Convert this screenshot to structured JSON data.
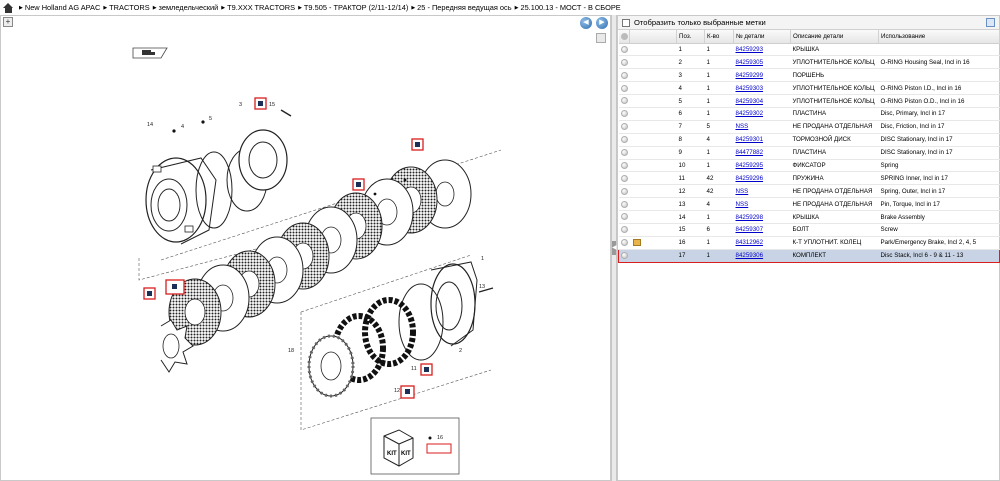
{
  "breadcrumb": [
    "New Holland AG APAC",
    "TRACTORS",
    "земледельческий",
    "T9.XXX TRACTORS",
    "T9.505 - ТРАКТОР (2/11-12/14)",
    "25 - Передняя ведущая ось",
    "25.100.13 - МОСТ - В СБОРЕ"
  ],
  "filter": {
    "label": "Отобразить только выбранные метки"
  },
  "table": {
    "headers": [
      "Поз.",
      "К-во",
      "№ детали",
      "Описание детали",
      "Использование"
    ],
    "rows": [
      {
        "pos": "1",
        "qty": "1",
        "part": "84259293",
        "desc": "КРЫШКА",
        "use": ""
      },
      {
        "pos": "2",
        "qty": "1",
        "part": "84259305",
        "desc": "УПЛОТНИТЕЛЬНОЕ КОЛЬЦ",
        "use": "O-RING Housing Seal, Incl in 16"
      },
      {
        "pos": "3",
        "qty": "1",
        "part": "84259299",
        "desc": "ПОРШЕНЬ",
        "use": ""
      },
      {
        "pos": "4",
        "qty": "1",
        "part": "84259303",
        "desc": "УПЛОТНИТЕЛЬНОЕ КОЛЬЦ",
        "use": "O-RING Piston I.D., Incl in 16"
      },
      {
        "pos": "5",
        "qty": "1",
        "part": "84259304",
        "desc": "УПЛОТНИТЕЛЬНОЕ КОЛЬЦ",
        "use": "O-RING Piston O.D., Incl in 16"
      },
      {
        "pos": "6",
        "qty": "1",
        "part": "84259302",
        "desc": "ПЛАСТИНА",
        "use": "Disc, Primary, Incl in 17"
      },
      {
        "pos": "7",
        "qty": "5",
        "part": "NSS",
        "desc": "НЕ ПРОДАНА ОТДЕЛЬНАЯ",
        "use": "Disc, Friction, Incl in 17"
      },
      {
        "pos": "8",
        "qty": "4",
        "part": "84259301",
        "desc": "ТОРМОЗНОЙ ДИСК",
        "use": "DISC Stationary, Incl in 17"
      },
      {
        "pos": "9",
        "qty": "1",
        "part": "84477882",
        "desc": "ПЛАСТИНА",
        "use": "DISC Stationary, Incl in 17"
      },
      {
        "pos": "10",
        "qty": "1",
        "part": "84259295",
        "desc": "ФИКСАТОР",
        "use": "Spring"
      },
      {
        "pos": "11",
        "qty": "42",
        "part": "84259296",
        "desc": "ПРУЖИНА",
        "use": "SPRING Inner, Incl in 17"
      },
      {
        "pos": "12",
        "qty": "42",
        "part": "NSS",
        "desc": "НЕ ПРОДАНА ОТДЕЛЬНАЯ",
        "use": "Spring, Outer, Incl in 17"
      },
      {
        "pos": "13",
        "qty": "4",
        "part": "NSS",
        "desc": "НЕ ПРОДАНА ОТДЕЛЬНАЯ",
        "use": "Pin, Torque, Incl in 17"
      },
      {
        "pos": "14",
        "qty": "1",
        "part": "84259298",
        "desc": "КРЫШКА",
        "use": "Brake Assembly"
      },
      {
        "pos": "15",
        "qty": "6",
        "part": "84259307",
        "desc": "БОЛТ",
        "use": "Screw"
      },
      {
        "pos": "16",
        "qty": "1",
        "part": "84312962",
        "desc": "К-Т УПЛОТНИТ. КОЛЕЦ",
        "use": "Park/Emergency Brake, Incl 2, 4, 5"
      },
      {
        "pos": "17",
        "qty": "1",
        "part": "84259306",
        "desc": "КОМПЛЕКТ",
        "use": "Disc Stack, Incl 6 - 9 & 11 - 13"
      }
    ]
  },
  "diagram": {
    "labels": [
      "1",
      "2",
      "3",
      "4",
      "5",
      "6",
      "7",
      "8",
      "9",
      "10",
      "11",
      "12",
      "13",
      "14",
      "15",
      "16",
      "17",
      "18"
    ],
    "kit_label": "KIT",
    "selected_item": "17"
  },
  "colors": {
    "highlight": "#d81e1e",
    "link": "#0000cc",
    "selected_row": "#c8d4e5"
  }
}
